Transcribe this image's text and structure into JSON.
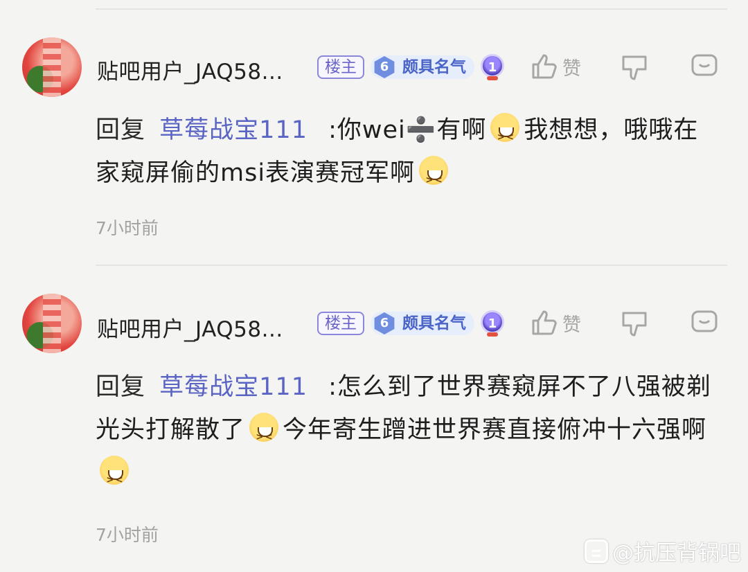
{
  "comments": [
    {
      "username": "贴吧用户_JAQ58...",
      "host_badge": "楼主",
      "level": "6",
      "level_title": "颇具名气",
      "medal": "1",
      "like_label": "赞",
      "reply_prefix": "回复",
      "reply_target": "草莓战宝111",
      "content_parts": [
        ":你wei",
        "➗",
        "有啊",
        "我想想，哦哦在家窥屏偷的msi表演赛冠军啊"
      ],
      "time": "7小时前"
    },
    {
      "username": "贴吧用户_JAQ58...",
      "host_badge": "楼主",
      "level": "6",
      "level_title": "颇具名气",
      "medal": "1",
      "like_label": "赞",
      "reply_prefix": "回复",
      "reply_target": "草莓战宝111",
      "content_parts": [
        ":怎么到了世界赛窥屏不了八强被剃光头打解散了",
        "今年寄生蹭进世界赛直接俯冲十六强啊"
      ],
      "time": "7小时前"
    }
  ],
  "watermark": "@抗压背锅吧",
  "icons": {
    "like": "thumbs-up-icon",
    "dislike": "thumbs-down-icon",
    "reply": "comment-bubble-icon",
    "emoji": "laughing-face-emoji"
  }
}
